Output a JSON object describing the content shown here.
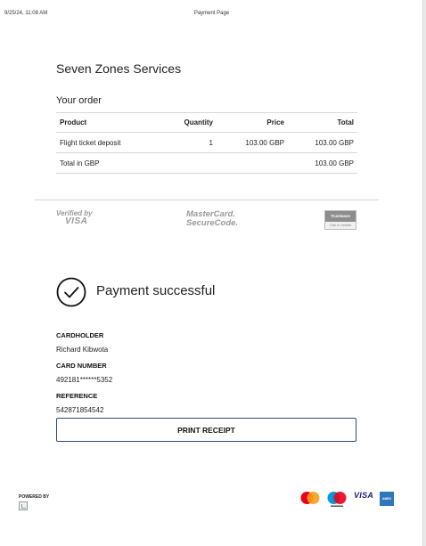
{
  "print_header": {
    "date": "9/25/24, 11:08 AM",
    "title": "Payment Page"
  },
  "merchant": "Seven Zones Services",
  "order": {
    "heading": "Your order",
    "columns": [
      "Product",
      "Quantity",
      "Price",
      "Total"
    ],
    "rows": [
      {
        "product": "Flight ticket deposit",
        "quantity": "1",
        "price": "103.00 GBP",
        "total": "103.00 GBP"
      }
    ],
    "total_label": "Total in GBP",
    "total_value": "103.00 GBP"
  },
  "security_logos": {
    "vbv_small": "Verified by",
    "vbv_big": "VISA",
    "mc_line1": "MasterCard.",
    "mc_line2": "SecureCode.",
    "trust_top": "Trustwave",
    "trust_bottom": "Click to Validate"
  },
  "status": {
    "text": "Payment successful",
    "icon": "check-circle-icon"
  },
  "details": {
    "cardholder_label": "CARDHOLDER",
    "cardholder_value": "Richard Kibwota",
    "card_number_label": "CARD NUMBER",
    "card_number_value": "492181******5352",
    "reference_label": "REFERENCE",
    "reference_value": "542871854542"
  },
  "print_button": "PRINT RECEIPT",
  "footer": {
    "powered_by": "POWERED BY",
    "visa": "VISA",
    "amex": "AMEX"
  },
  "colors": {
    "button_border": "#2b4c7e",
    "mc_red": "#eb001b",
    "mc_orange": "#f79e1b",
    "maestro_blue": "#0099df",
    "visa_blue": "#1a1f71",
    "amex_blue": "#2e77bb"
  }
}
